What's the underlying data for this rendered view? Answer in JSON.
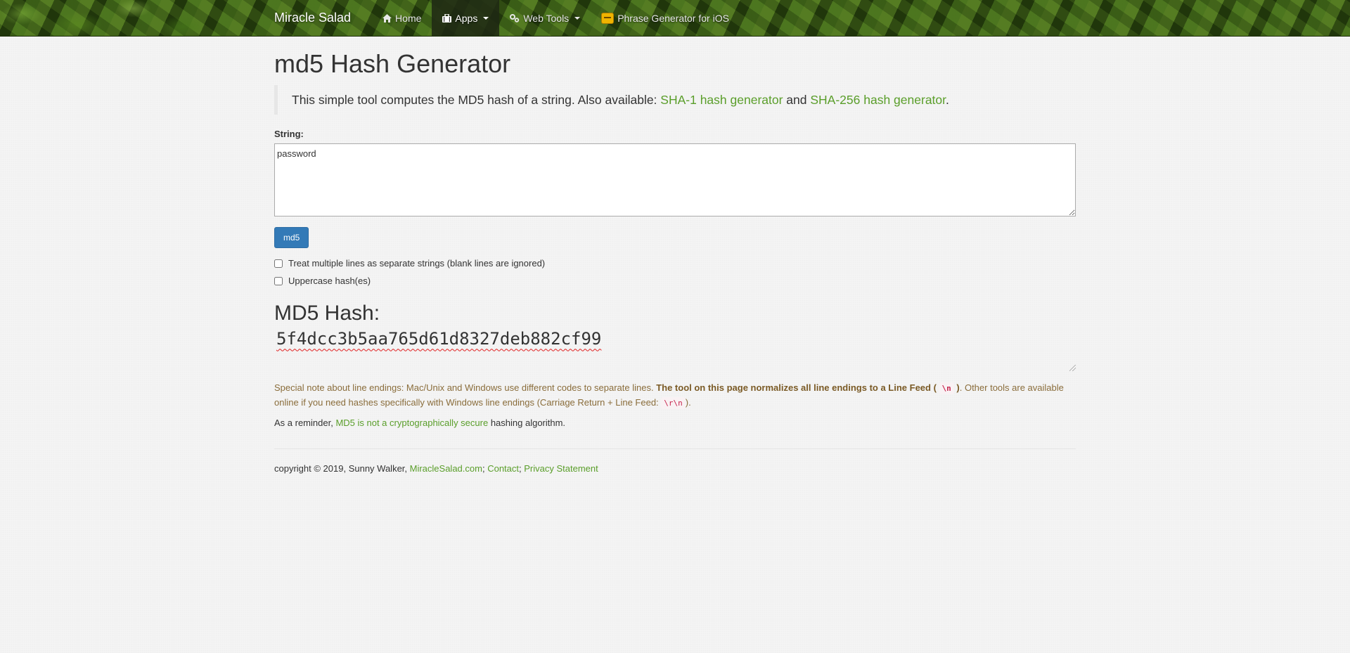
{
  "nav": {
    "brand": "Miracle Salad",
    "items": [
      {
        "label": "Home",
        "icon": "home-icon"
      },
      {
        "label": "Apps",
        "icon": "briefcase-icon"
      },
      {
        "label": "Web Tools",
        "icon": "gears-icon"
      },
      {
        "label": "Phrase Generator for iOS",
        "icon": "app-icon"
      }
    ]
  },
  "page": {
    "title": "md5 Hash Generator",
    "intro": {
      "text": "This simple tool computes the MD5 hash of a string. Also available: ",
      "link1": "SHA-1 hash generator",
      "and": " and ",
      "link2": "SHA-256 hash generator",
      "end": "."
    },
    "string_label": "String:",
    "string_value": "password",
    "button_label": "md5",
    "checkbox_multiline": "Treat multiple lines as separate strings (blank lines are ignored)",
    "checkbox_uppercase": "Uppercase hash(es)",
    "result_heading": "MD5 Hash:",
    "result_hash": "5f4dcc3b5aa765d61d8327deb882cf99",
    "note": {
      "text1": "Special note about line endings: Mac/Unix and Windows use different codes to separate lines. ",
      "bold": "The tool on this page normalizes all line endings to a Line Feed ( ",
      "code1": "\\n",
      "bold_end": " )",
      "text2": ". Other tools are available online if you need hashes specifically with Windows line endings (Carriage Return + Line Feed: ",
      "code2": "\\r\\n",
      "text3": ")."
    },
    "reminder": {
      "pre": "As a reminder, ",
      "link": "MD5 is not a cryptographically secure",
      "post": " hashing algorithm."
    },
    "footer": {
      "text": "copyright © 2019, Sunny Walker, ",
      "link_site": "MiracleSalad.com",
      "sep1": "; ",
      "link_contact": "Contact",
      "sep2": "; ",
      "link_privacy": "Privacy Statement"
    }
  },
  "colors": {
    "link": "#5a9e2a",
    "button": "#337ab7",
    "note": "#8a6d3b"
  }
}
